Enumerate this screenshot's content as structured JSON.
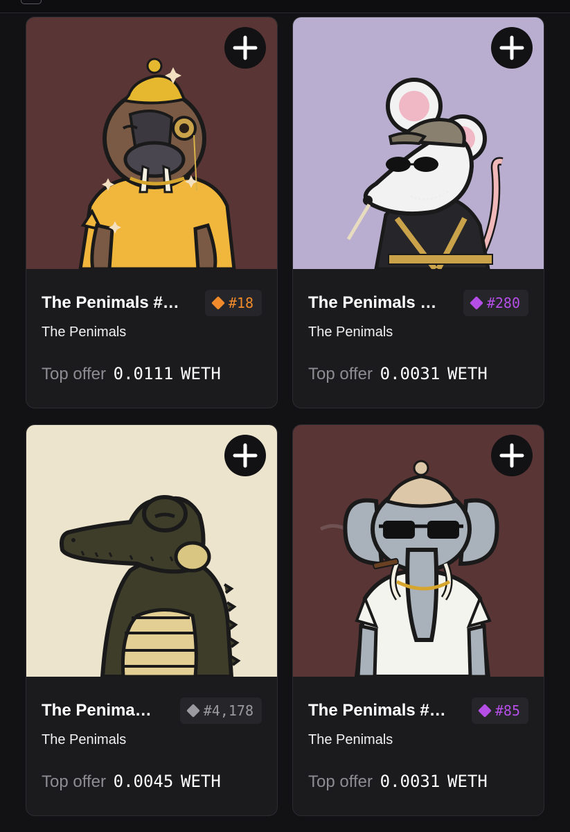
{
  "cards": [
    {
      "title": "The Penimals #…",
      "collection": "The Penimals",
      "rank": "#18",
      "rank_color": "#f08a2a",
      "offer_label": "Top offer",
      "offer_value": "0.0111",
      "offer_currency": "WETH",
      "bg_color": "#5a3535",
      "animal": "walrus",
      "add_icon": "plus-icon"
    },
    {
      "title": "The Penimals …",
      "collection": "The Penimals",
      "rank": "#280",
      "rank_color": "#b44ee6",
      "offer_label": "Top offer",
      "offer_value": "0.0031",
      "offer_currency": "WETH",
      "bg_color": "#b9aed0",
      "animal": "rat",
      "add_icon": "plus-icon"
    },
    {
      "title": "The Penima…",
      "collection": "The Penimals",
      "rank": "#4,178",
      "rank_color": "#9a9aa0",
      "offer_label": "Top offer",
      "offer_value": "0.0045",
      "offer_currency": "WETH",
      "bg_color": "#ece4cc",
      "animal": "crocodile",
      "add_icon": "plus-icon"
    },
    {
      "title": "The Penimals #…",
      "collection": "The Penimals",
      "rank": "#85",
      "rank_color": "#b44ee6",
      "offer_label": "Top offer",
      "offer_value": "0.0031",
      "offer_currency": "WETH",
      "bg_color": "#5a3535",
      "animal": "elephant",
      "add_icon": "plus-icon"
    }
  ]
}
